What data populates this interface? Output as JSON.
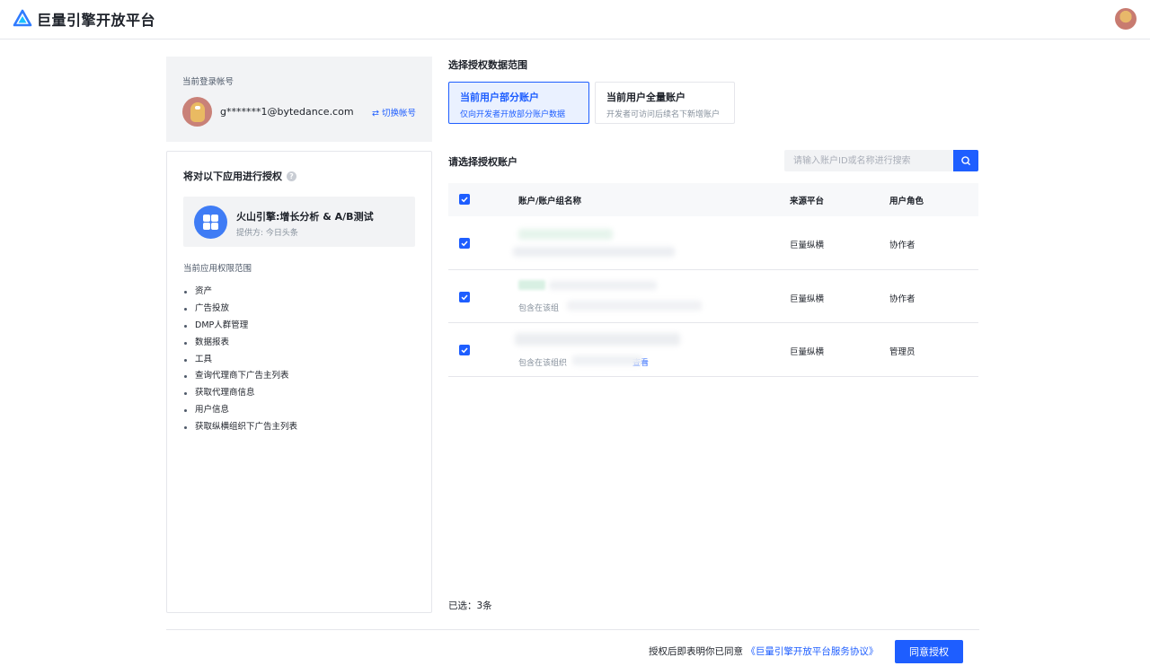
{
  "header": {
    "brand": "巨量引擎开放平台"
  },
  "account": {
    "title": "当前登录帐号",
    "email": "g*******1@bytedance.com",
    "switch_label": "⇄ 切换帐号"
  },
  "app": {
    "heading": "将对以下应用进行授权",
    "name": "火山引擎:增长分析 & A/B测试",
    "provider": "提供方: 今日头条",
    "perm_title": "当前应用权限范围",
    "permissions": [
      "资产",
      "广告投放",
      "DMP人群管理",
      "数据报表",
      "工具",
      "查询代理商下广告主列表",
      "获取代理商信息",
      "用户信息",
      "获取纵横组织下广告主列表"
    ]
  },
  "scope": {
    "label": "选择授权数据范围",
    "options": [
      {
        "title": "当前用户部分账户",
        "desc": "仅向开发者开放部分账户数据",
        "selected": true
      },
      {
        "title": "当前用户全量账户",
        "desc": "开发者可访问后续名下新增账户",
        "selected": false
      }
    ]
  },
  "accounts": {
    "label": "请选择授权账户",
    "search_placeholder": "请输入账户ID或名称进行搜索",
    "columns": [
      "账户/账户组名称",
      "来源平台",
      "用户角色"
    ],
    "rows": [
      {
        "source": "巨量纵横",
        "role": "协作者",
        "subtext": ""
      },
      {
        "source": "巨量纵横",
        "role": "协作者",
        "subtext": "包含在该组"
      },
      {
        "source": "巨量纵横",
        "role": "管理员",
        "subtext": "包含在该组织",
        "link": "查看"
      }
    ]
  },
  "footer": {
    "selected_count": "已选：3条",
    "agree_prefix": "授权后即表明你已同意",
    "agree_link": "《巨量引擎开放平台服务协议》",
    "agree_button": "同意授权"
  }
}
